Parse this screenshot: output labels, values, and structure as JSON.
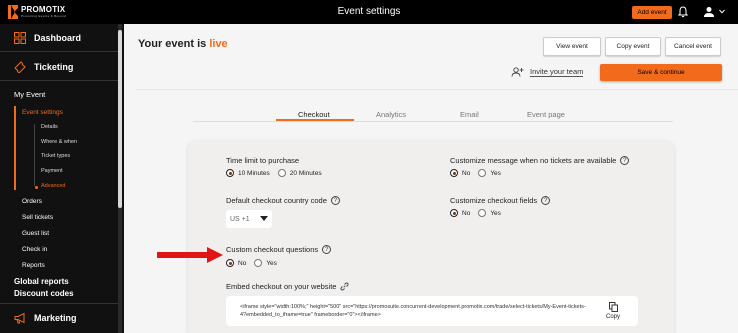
{
  "brand": {
    "name": "PROMOTIX",
    "tagline": "Promoting Events & Beyond",
    "accent": "#f26a1b"
  },
  "topbar": {
    "title": "Event settings",
    "add_event": "Add event"
  },
  "sidebar": {
    "dashboard": "Dashboard",
    "ticketing": "Ticketing",
    "my_event": "My Event",
    "event_settings": "Event settings",
    "sub": [
      "Details",
      "Where & when",
      "Ticket types",
      "Payment",
      "Advanced"
    ],
    "orders": "Orders",
    "sell_tickets": "Sell tickets",
    "guest_list": "Guest list",
    "check_in": "Check in",
    "reports": "Reports",
    "global_reports": "Global reports",
    "discount_codes": "Discount codes",
    "marketing": "Marketing"
  },
  "header": {
    "status_prefix": "Your event is",
    "status_value": "live",
    "view_event": "View event",
    "copy_event": "Copy event",
    "cancel_event": "Cancel event",
    "invite_team": "Invite your team",
    "save_continue": "Save & continue"
  },
  "tabs": [
    "Checkout",
    "Analytics",
    "Email",
    "Event page"
  ],
  "form": {
    "time_limit": {
      "label": "Time limit to purchase",
      "options": [
        "10 Minutes",
        "20 Minutes"
      ],
      "selected": "10 Minutes"
    },
    "custom_msg": {
      "label": "Customize message when no tickets are available",
      "options": [
        "No",
        "Yes"
      ],
      "selected": "No"
    },
    "country_code": {
      "label": "Default checkout country code",
      "value": "US +1"
    },
    "custom_fields": {
      "label": "Customize checkout fields",
      "options": [
        "No",
        "Yes"
      ],
      "selected": "No"
    },
    "custom_questions": {
      "label": "Custom checkout questions",
      "options": [
        "No",
        "Yes"
      ],
      "selected": "No"
    },
    "embed": {
      "label": "Embed checkout on your website",
      "code": "<iframe style=\"width:100%;\" height=\"500\" src=\"https://promosuite.concurrent-development.promotix.com/trade/select-tickets/My-Event-tickets-4?embedded_to_iframe=true\" frameborder=\"0\"></iframe>",
      "copy_label": "Copy"
    }
  }
}
